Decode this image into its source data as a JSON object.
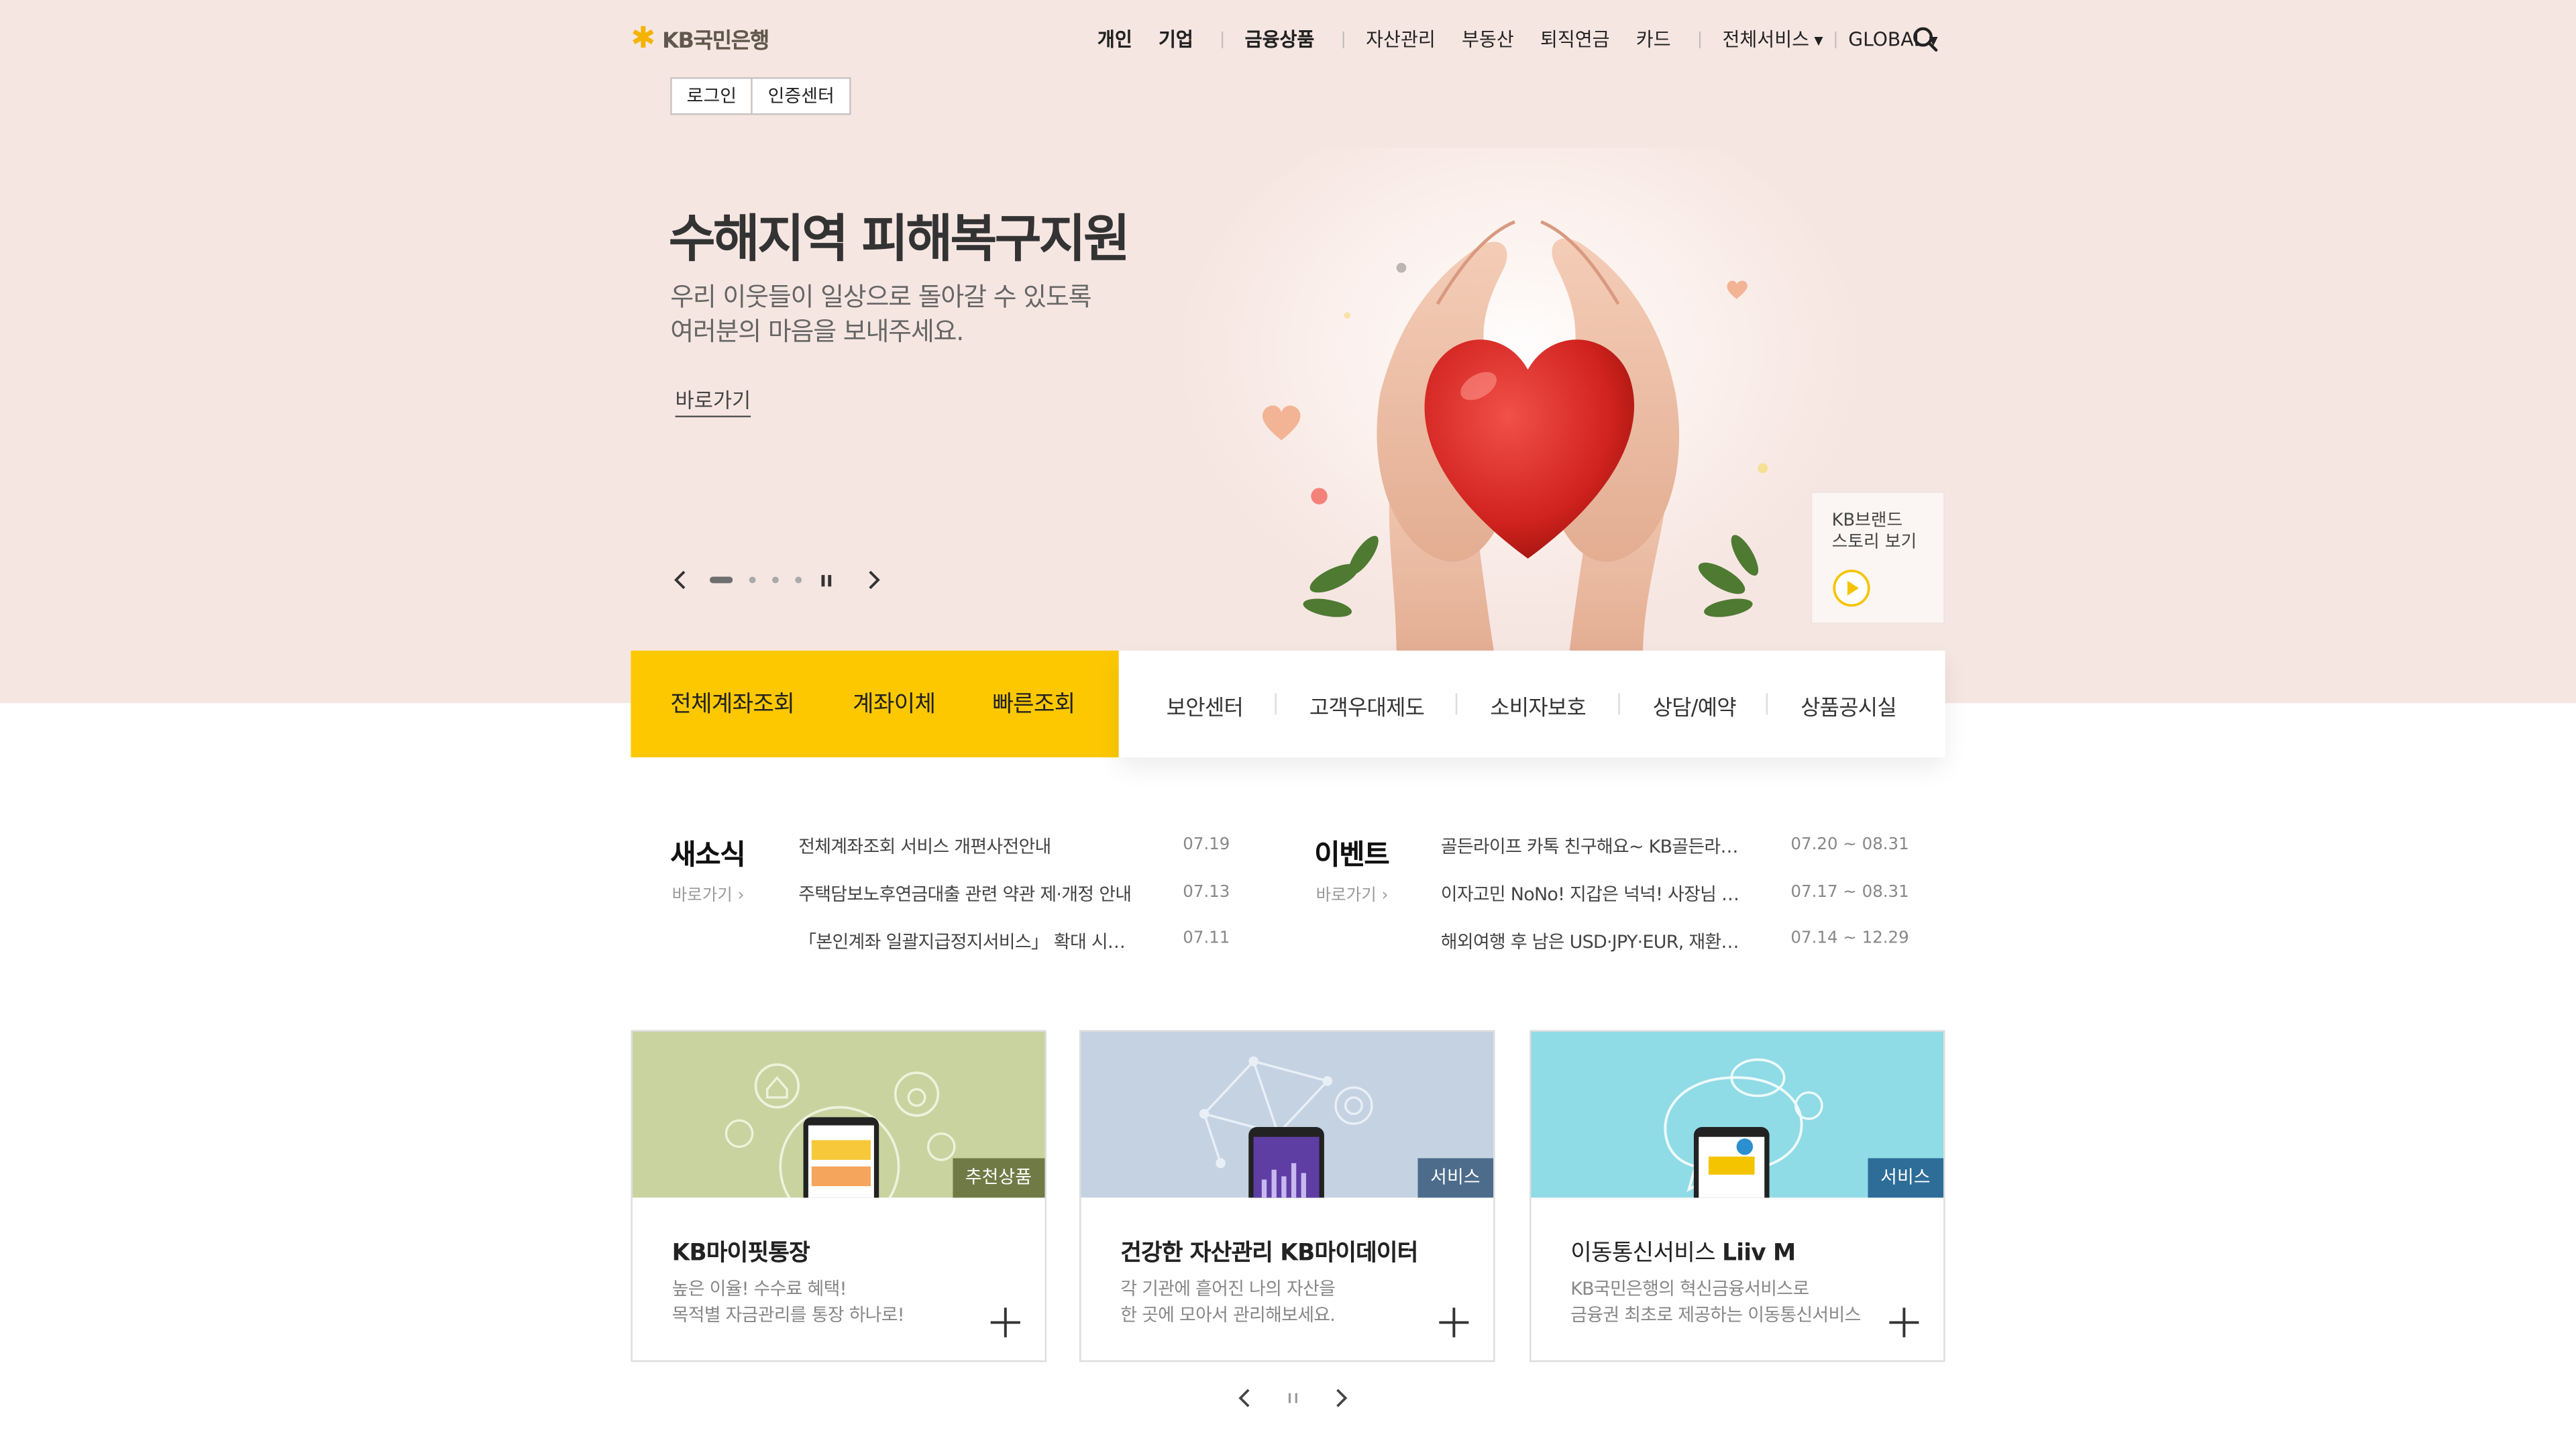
{
  "header": {
    "logo_text": "KB국민은행",
    "nav": [
      "개인",
      "기업",
      "금융상품",
      "자산관리",
      "부동산",
      "퇴직연금",
      "카드",
      "전체서비스",
      "GLOBAL"
    ],
    "login_label": "로그인",
    "cert_label": "인증센터"
  },
  "hero": {
    "title": "수해지역 피해복구지원",
    "desc_line1": "우리 이웃들이 일상으로 돌아갈 수 있도록",
    "desc_line2": "여러분의 마음을 보내주세요.",
    "link_label": "바로가기",
    "slide_count": 4,
    "active_slide": 1
  },
  "brand_story": {
    "line1": "KB브랜드",
    "line2": "스토리 보기"
  },
  "quick_menu": {
    "primary": [
      "전체계좌조회",
      "계좌이체",
      "빠른조회"
    ],
    "secondary": [
      "보안센터",
      "고객우대제도",
      "소비자보호",
      "상담/예약",
      "상품공시실"
    ]
  },
  "news": {
    "title": "새소식",
    "more_label": "바로가기",
    "items": [
      {
        "text": "전체계좌조회 서비스 개편사전안내",
        "date": "07.19"
      },
      {
        "text": "주택담보노후연금대출 관련 약관 제·개정 안내",
        "date": "07.13"
      },
      {
        "text": "「본인계좌 일괄지급정지서비스」 확대 시행 안내",
        "date": "07.11"
      }
    ]
  },
  "events": {
    "title": "이벤트",
    "more_label": "바로가기",
    "items": [
      {
        "text": "골든라이프 카톡 친구해요~ KB골든라이프 이벤트",
        "date": "07.20 ~ 08.31"
      },
      {
        "text": "이자고민 NoNo! 지갑은 넉넉! 사장님 이벤트",
        "date": "07.17 ~ 08.31"
      },
      {
        "text": "해외여행 후 남은 USD·JPY·EUR, 재환전 이벤트",
        "date": "07.14 ~ 12.29"
      }
    ]
  },
  "cards": [
    {
      "badge": "추천상품",
      "title": "KB마이핏통장",
      "desc1": "높은 이율! 수수료 혜택!",
      "desc2": "목적별 자금관리를 통장 하나로!"
    },
    {
      "badge": "서비스",
      "title": "건강한 자산관리 KB마이데이터",
      "desc1": "각 기관에 흩어진 나의 자산을",
      "desc2": "한 곳에 모아서 관리해보세요."
    },
    {
      "badge": "서비스",
      "title_prefix": "이동통신서비스 ",
      "title_strong": "Liiv M",
      "desc1": "KB국민은행의 혁신금융서비스로",
      "desc2": "금융권 최초로 제공하는 이동통신서비스"
    }
  ],
  "colors": {
    "brand_yellow": "#fdc800",
    "hero_bg": "#f6e6e2",
    "badge_green": "#6f7a45",
    "badge_blue": "#4d6c8c",
    "badge_teal": "#2d6d98"
  }
}
